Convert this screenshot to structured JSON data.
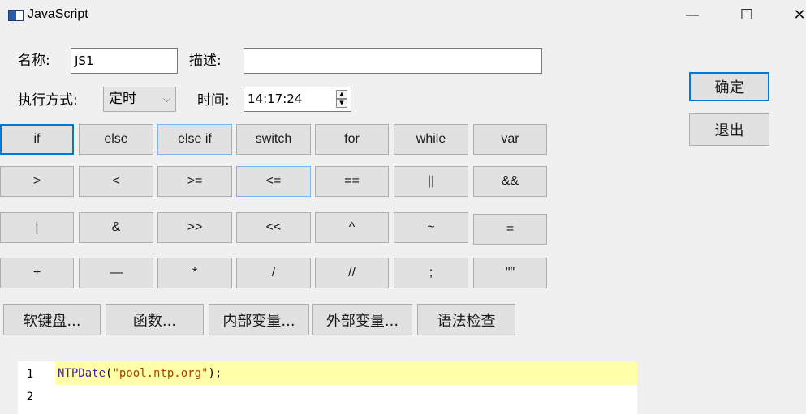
{
  "window": {
    "title": "JavaScript",
    "minimize_glyph": "—",
    "maximize_glyph": "☐",
    "close_glyph": "✕"
  },
  "form": {
    "name_label": "名称:",
    "name_value": "JS1",
    "desc_label": "描述:",
    "desc_value": "",
    "mode_label": "执行方式:",
    "mode_value": "定时",
    "time_label": "时间:",
    "time_value": "14:17:24"
  },
  "actions": {
    "ok": "确定",
    "exit": "退出"
  },
  "keyword_buttons": {
    "row1": [
      "if",
      "else",
      "else if",
      "switch",
      "for",
      "while",
      "var"
    ],
    "row2": [
      ">",
      "<",
      ">=",
      "<=",
      "==",
      "||",
      "&&"
    ],
    "row3": [
      "|",
      "&",
      ">>",
      "<<",
      "^",
      "~",
      "="
    ],
    "row4": [
      "+",
      "—",
      "*",
      "/",
      "//",
      ";",
      "\"\""
    ]
  },
  "tool_buttons": [
    "软键盘...",
    "函数...",
    "内部变量...",
    "外部变量...",
    "语法检查"
  ],
  "editor": {
    "lines": [
      {
        "num": "1",
        "fn": "NTPDate",
        "open": "(",
        "str": "\"pool.ntp.org\"",
        "close": ");"
      },
      {
        "num": "2"
      }
    ]
  },
  "colors": {
    "focus": "#0078d7",
    "line_highlight": "#ffffa8"
  }
}
